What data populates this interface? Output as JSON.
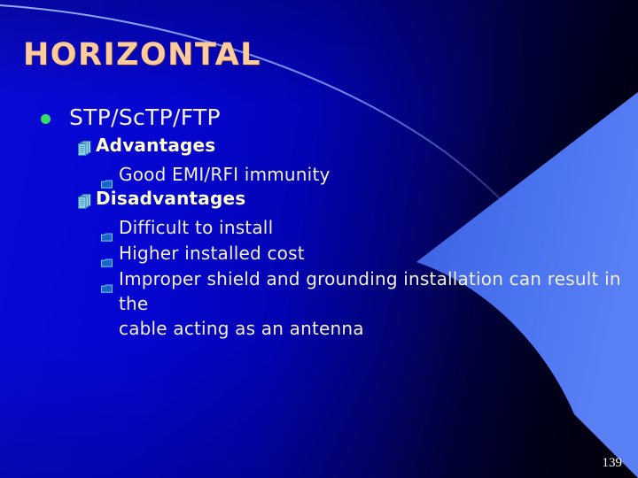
{
  "slide": {
    "title": "HORIZONTAL",
    "page_number": "139",
    "colors": {
      "title": "#FFCC99",
      "body_text": "#F2F0D8",
      "heading_text": "#FFFFCC",
      "level1_bullet": "#33DD66",
      "level2_bullet": "#66CCEE",
      "level3_bullet": "#55BBEE",
      "background_bright_blue": "#0A0AD8",
      "background_dark_navy": "#000006",
      "accent_wedge": "#4169E8",
      "thin_arc_line": "#8FA8F5"
    },
    "content": [
      {
        "level": 1,
        "bullet": "filled-circle-bullet",
        "text": "STP/ScTP/FTP"
      },
      {
        "level": 2,
        "bullet": "stacked-pages-bullet",
        "text": "Advantages"
      },
      {
        "level": 3,
        "bullet": "small-box-bullet",
        "text": "Good EMI/RFI immunity"
      },
      {
        "level": 2,
        "bullet": "stacked-pages-bullet",
        "text": "Disadvantages"
      },
      {
        "level": 3,
        "bullet": "small-box-bullet",
        "text": "Difficult to install"
      },
      {
        "level": 3,
        "bullet": "small-box-bullet",
        "text": "Higher installed cost"
      },
      {
        "level": 3,
        "bullet": "small-box-bullet",
        "text": "Improper shield and grounding installation can result in the",
        "continuation": "cable acting as an antenna"
      }
    ]
  }
}
